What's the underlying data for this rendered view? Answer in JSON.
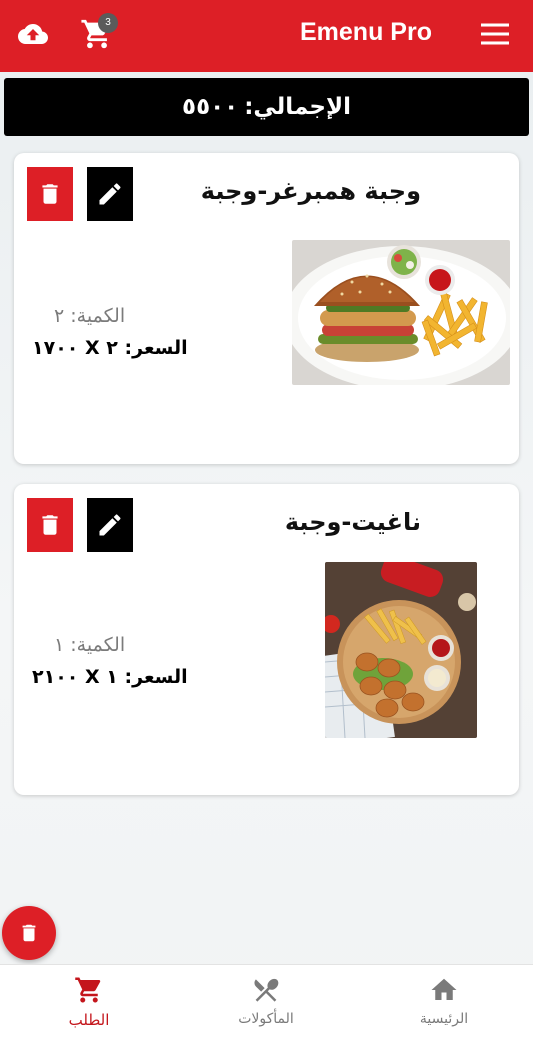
{
  "header": {
    "title": "Emenu Pro",
    "cart_count": "3",
    "upload_icon": "cloud-upload-icon",
    "cart_icon": "cart-icon",
    "menu_icon": "menu-icon"
  },
  "total": {
    "label": "الإجمالي:",
    "value": "٥٥٠٠"
  },
  "items": [
    {
      "name": "وجبة همبرغر-وجبة",
      "quantity": "الكمية: ٢",
      "price": "السعر: ٢ X ١٧٠٠",
      "image": "burger-meal-photo"
    },
    {
      "name": "ناغيت-وجبة",
      "quantity": "الكمية: ١",
      "price": "السعر: ١ X ٢١٠٠",
      "image": "nuggets-meal-photo"
    }
  ],
  "bottom_nav": [
    {
      "label": "الطلب",
      "icon": "cart-icon",
      "active": true
    },
    {
      "label": "المأكولات",
      "icon": "cutlery-icon",
      "active": false
    },
    {
      "label": "الرئيسية",
      "icon": "home-icon",
      "active": false
    }
  ],
  "colors": {
    "brand_red": "#dd1f26",
    "active_nav": "#c4161c",
    "black_bar": "#000000"
  }
}
